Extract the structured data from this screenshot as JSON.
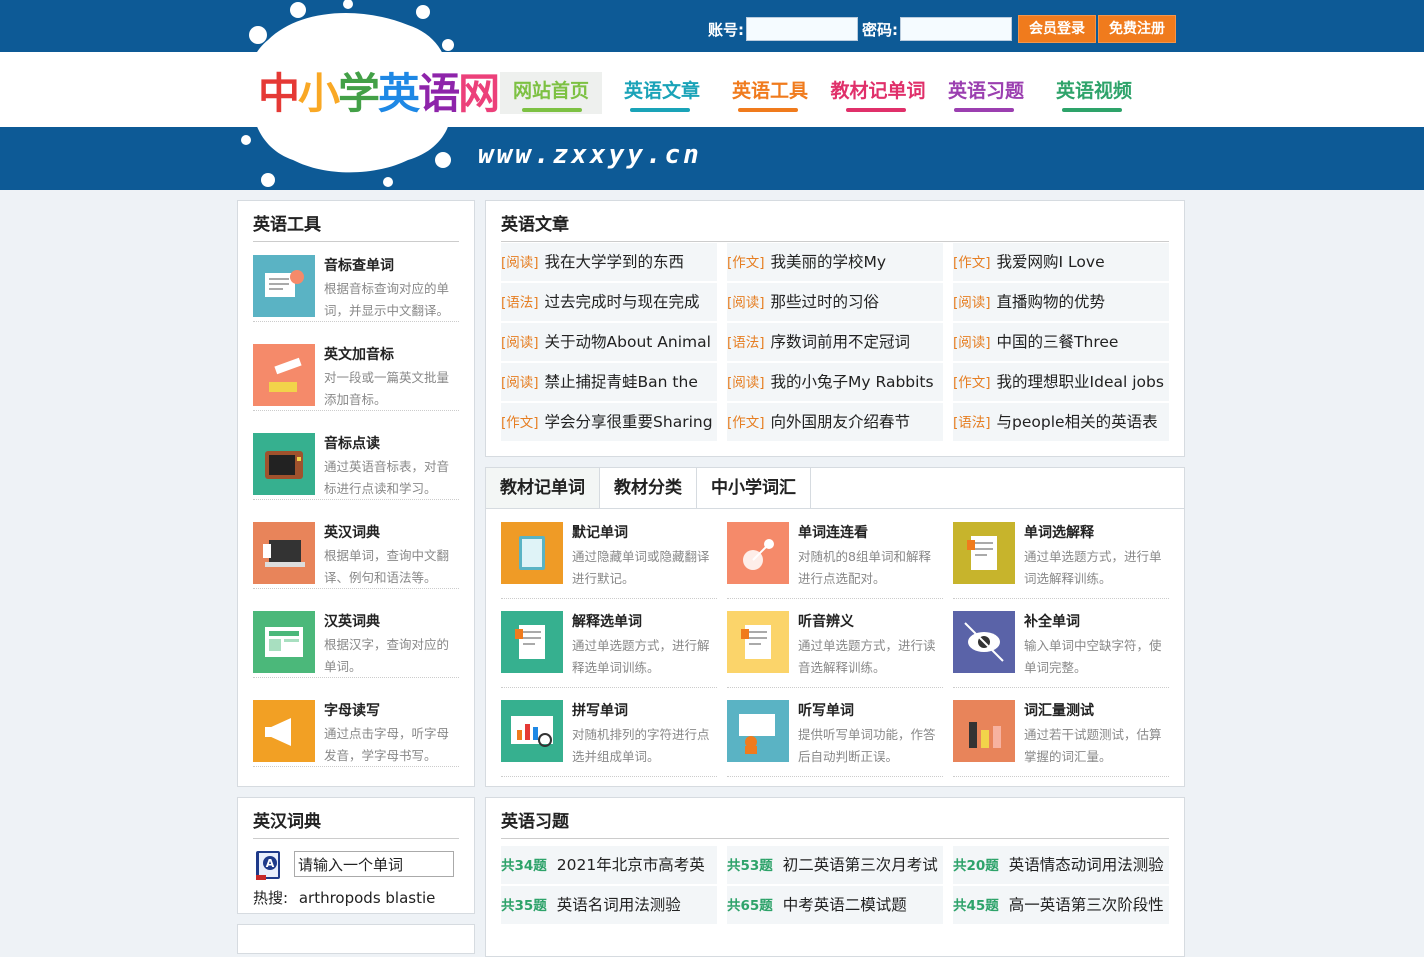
{
  "login": {
    "account_label": "账号:",
    "password_label": "密码:",
    "login_button": "会员登录",
    "register_button": "免费注册"
  },
  "logo": {
    "text": "中小学英语网",
    "url": "www.zxxyy.cn"
  },
  "nav": [
    {
      "label": "网站首页",
      "color": "#7dc143"
    },
    {
      "label": "英语文章",
      "color": "#1aa3b8"
    },
    {
      "label": "英语工具",
      "color": "#f07b1d"
    },
    {
      "label": "教材记单词",
      "color": "#e0306a"
    },
    {
      "label": "英语习题",
      "color": "#9b3fb0"
    },
    {
      "label": "英语视频",
      "color": "#2ea36a"
    }
  ],
  "tools": {
    "title": "英语工具",
    "items": [
      {
        "title": "音标查单词",
        "desc": "根据音标查询对应的单词，并显示中文翻译。",
        "color": "#5ab3c4",
        "icon": "book-list-icon"
      },
      {
        "title": "英文加音标",
        "desc": "对一段或一篇英文批量添加音标。",
        "color": "#f58a6a",
        "icon": "telescope-icon"
      },
      {
        "title": "音标点读",
        "desc": "通过英语音标表，对音标进行点读和学习。",
        "color": "#36b08f",
        "icon": "tv-icon"
      },
      {
        "title": "英汉词典",
        "desc": "根据单词，查询中文翻译、例句和语法等。",
        "color": "#e8845a",
        "icon": "laptop-icon"
      },
      {
        "title": "汉英词典",
        "desc": "根据汉字，查询对应的单词。",
        "color": "#4bb87a",
        "icon": "web-page-icon"
      },
      {
        "title": "字母读写",
        "desc": "通过点击字母，听字母发音，学字母书写。",
        "color": "#f2a024",
        "icon": "megaphone-icon"
      }
    ]
  },
  "articles": {
    "title": "英语文章",
    "items": [
      {
        "tag": "[阅读]",
        "text": "我在大学学到的东西"
      },
      {
        "tag": "[作文]",
        "text": "我美丽的学校My"
      },
      {
        "tag": "[作文]",
        "text": "我爱网购I Love"
      },
      {
        "tag": "[语法]",
        "text": "过去完成时与现在完成"
      },
      {
        "tag": "[阅读]",
        "text": "那些过时的习俗"
      },
      {
        "tag": "[阅读]",
        "text": "直播购物的优势"
      },
      {
        "tag": "[阅读]",
        "text": "关于动物About Animal"
      },
      {
        "tag": "[语法]",
        "text": "序数词前用不定冠词"
      },
      {
        "tag": "[阅读]",
        "text": "中国的三餐Three"
      },
      {
        "tag": "[阅读]",
        "text": "禁止捕捉青蛙Ban the"
      },
      {
        "tag": "[阅读]",
        "text": "我的小兔子My Rabbits"
      },
      {
        "tag": "[作文]",
        "text": "我的理想职业Ideal jobs"
      },
      {
        "tag": "[作文]",
        "text": "学会分享很重要Sharing"
      },
      {
        "tag": "[作文]",
        "text": "向外国朋友介绍春节"
      },
      {
        "tag": "[语法]",
        "text": "与people相关的英语表"
      }
    ]
  },
  "words": {
    "tabs": [
      "教材记单词",
      "教材分类",
      "中小学词汇"
    ],
    "items": [
      {
        "title": "默记单词",
        "desc": "通过隐藏单词或隐藏翻译进行默记。",
        "color": "#ef9b26",
        "icon": "notebook-icon"
      },
      {
        "title": "单词连连看",
        "desc": "对随机的8组单词和解释进行点选配对。",
        "color": "#f58a6a",
        "icon": "globe-network-icon"
      },
      {
        "title": "单词选解释",
        "desc": "通过单选题方式，进行单词选解释训练。",
        "color": "#c7b42c",
        "icon": "document-icon"
      },
      {
        "title": "解释选单词",
        "desc": "通过单选题方式，进行解释选单词训练。",
        "color": "#36b08f",
        "icon": "document-icon"
      },
      {
        "title": "听音辨义",
        "desc": "通过单选题方式，进行读音选解释训练。",
        "color": "#fbd46a",
        "icon": "document-icon"
      },
      {
        "title": "补全单词",
        "desc": "输入单词中空缺字符，使单词完整。",
        "color": "#5a63a8",
        "icon": "eye-icon"
      },
      {
        "title": "拼写单词",
        "desc": "对随机排列的字符进行点选并组成单词。",
        "color": "#36b08f",
        "icon": "monitor-chart-icon"
      },
      {
        "title": "听写单词",
        "desc": "提供听写单词功能，作答后自动判断正误。",
        "color": "#5ab3c4",
        "icon": "person-board-icon"
      },
      {
        "title": "词汇量测试",
        "desc": "通过若干试题测试，估算掌握的词汇量。",
        "color": "#e8845a",
        "icon": "bar-chart-icon"
      }
    ]
  },
  "dict": {
    "title": "英汉词典",
    "placeholder": "请输入一个单词",
    "hot_label": "热搜:",
    "hot_words": "arthropods blastie"
  },
  "exercises": {
    "title": "英语习题",
    "items": [
      {
        "count": "共34题",
        "text": "2021年北京市高考英"
      },
      {
        "count": "共53题",
        "text": "初二英语第三次月考试"
      },
      {
        "count": "共20题",
        "text": "英语情态动词用法测验"
      },
      {
        "count": "共35题",
        "text": "英语名词用法测验"
      },
      {
        "count": "共65题",
        "text": "中考英语二模试题"
      },
      {
        "count": "共45题",
        "text": "高一英语第三次阶段性"
      }
    ]
  }
}
